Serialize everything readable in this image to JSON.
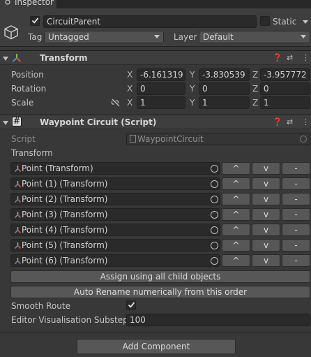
{
  "tab": {
    "label": "Inspector"
  },
  "object": {
    "name": "CircuitParent",
    "active": true,
    "static_label": "Static",
    "static_checked": false,
    "tag_label": "Tag",
    "tag_value": "Untagged",
    "layer_label": "Layer",
    "layer_value": "Default"
  },
  "transform": {
    "title": "Transform",
    "rows": [
      {
        "label": "Position",
        "x": "-6.161319",
        "y": "-3.830539",
        "z": "-3.957772"
      },
      {
        "label": "Rotation",
        "x": "0",
        "y": "0",
        "z": "0"
      },
      {
        "label": "Scale",
        "x": "1",
        "y": "1",
        "z": "1"
      }
    ],
    "axis_x": "X",
    "axis_y": "Y",
    "axis_z": "Z"
  },
  "waypoint": {
    "title": "Waypoint Circuit (Script)",
    "script_label": "Script",
    "script_value": "WaypointCircuit",
    "transform_label": "Transform",
    "points": [
      "Point (Transform)",
      "Point (1) (Transform)",
      "Point (2) (Transform)",
      "Point (3) (Transform)",
      "Point (4) (Transform)",
      "Point (5) (Transform)",
      "Point (6) (Transform)"
    ],
    "up_label": "^",
    "down_label": "v",
    "remove_label": "-",
    "assign_button": "Assign using all child objects",
    "rename_button": "Auto Rename numerically from this order",
    "smooth_label": "Smooth Route",
    "smooth_checked": true,
    "substeps_label": "Editor Visualisation Substeps",
    "substeps_value": "100"
  },
  "add_component": "Add Component",
  "colors": {
    "panel": "#383838",
    "header": "#3e3e3e",
    "field": "#2a2a2a",
    "button": "#575757",
    "transform_icon_red": "#e0503a",
    "transform_icon_green": "#7ec345",
    "transform_icon_blue": "#4f8be0"
  }
}
